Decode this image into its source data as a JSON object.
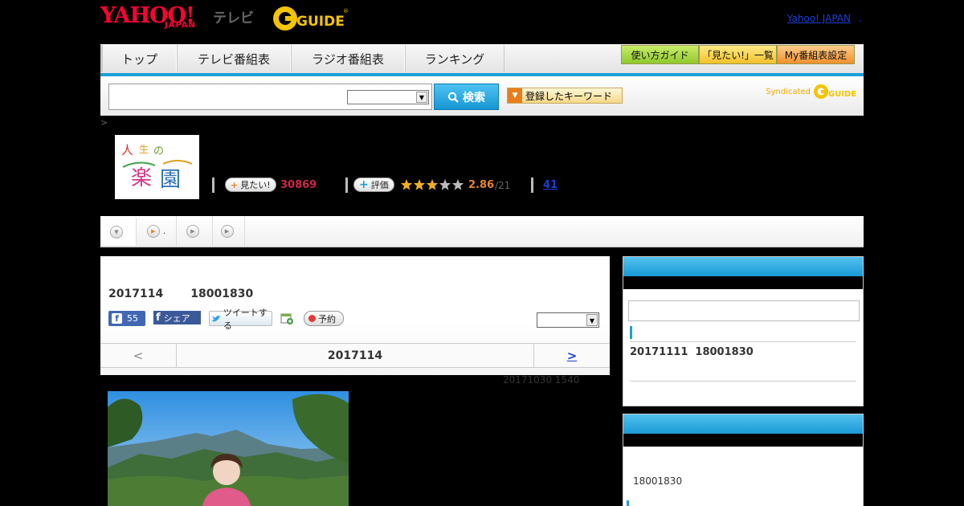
{
  "header": {
    "logo_yahoo": "YAHOO!",
    "logo_japan": "JAPAN",
    "logo_tv": "テレビ",
    "logo_gguide": "G-GUIDE",
    "yahoo_japan_link": "Yahoo! JAPAN",
    "link_separator": "."
  },
  "nav": {
    "tabs": [
      "トップ",
      "テレビ番組表",
      "ラジオ番組表",
      "ランキング"
    ],
    "buttons": [
      "使い方ガイド",
      "「見たい!」一覧",
      "My番組表設定"
    ]
  },
  "search": {
    "input_value": "",
    "select_value": "",
    "button_label": "検索",
    "keyword_button_label": "登録したキーワード",
    "syndicated_label": "Syndicated",
    "syndicated_logo": "G-GUIDE"
  },
  "breadcrumb": ">",
  "program": {
    "thumb_title": "人生の楽園",
    "mitai_label": "見たい!",
    "mitai_count": "30869",
    "rating_label": "評価",
    "rating_stars": 2.86,
    "rating_value": "2.86",
    "rating_denominator": "/21",
    "review_count": "41"
  },
  "subtabs": [
    {
      "label": ""
    },
    {
      "label": "."
    },
    {
      "label": ""
    },
    {
      "label": ""
    }
  ],
  "episode": {
    "title": "2017114       18001830",
    "fb_like_count": "55",
    "fb_share_label": "シェア",
    "tweet_label": "ツイートする",
    "reserve_label": "予約",
    "select_value": "",
    "pager_prev": "<",
    "pager_date": "2017114",
    "pager_next": ">",
    "updated": "20171030  1540"
  },
  "side1": {
    "input_value": "",
    "entry": "20171111  18001830"
  },
  "side2": {
    "entry": "18001830"
  },
  "colors": {
    "accent_blue": "#1aa0d8",
    "yahoo_red": "#ff0033",
    "mitai_pink": "#d0264b",
    "rating_orange": "#e8852a",
    "link_blue": "#1a3fd6"
  }
}
